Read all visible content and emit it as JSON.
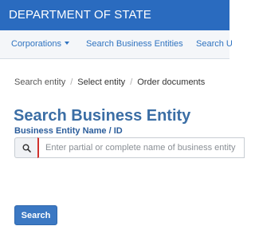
{
  "header": {
    "title": "DEPARTMENT OF STATE"
  },
  "nav": {
    "items": [
      {
        "label": "Corporations",
        "icon": "caret-down-icon"
      },
      {
        "label": "Search Business Entities"
      },
      {
        "label": "Search U"
      }
    ]
  },
  "breadcrumb": {
    "items": [
      "Search entity",
      "Select entity",
      "Order documents"
    ]
  },
  "main": {
    "title": "Search Business Entity",
    "field_label": "Business Entity Name / ID",
    "search_icon": "search-icon",
    "search_placeholder": "Enter partial or complete name of business entity o",
    "search_value": "",
    "search_button": "Search"
  },
  "colors": {
    "header_bg": "#2a6bbf",
    "link": "#2f73c0",
    "title": "#3b6ea5",
    "button": "#3b78c3",
    "input_accent": "#d0312d"
  }
}
